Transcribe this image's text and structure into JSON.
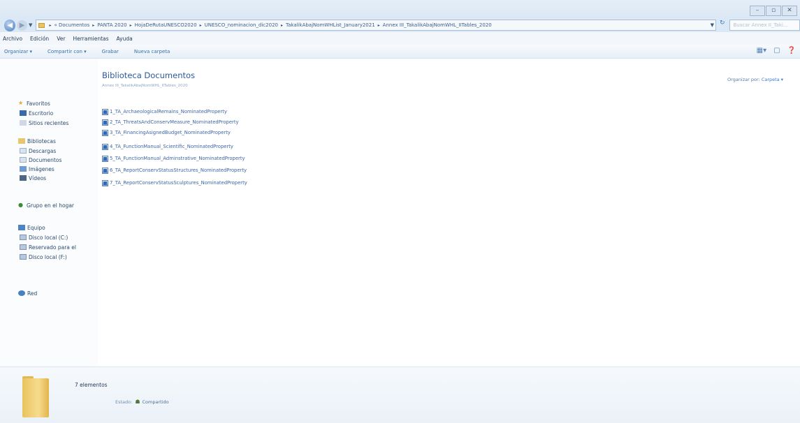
{
  "window": {
    "controls": [
      "–",
      "▫",
      "✕"
    ]
  },
  "address": {
    "back_icon": "back-arrow-icon",
    "forward_icon": "forward-arrow-icon",
    "dropdown_glyph": "▼",
    "breadcrumbs": [
      "« Documentos",
      "PANTA 2020",
      "HojaDeRutaUNESCO2020",
      "UNESCO_nominacion_dic2020",
      "TakalikAbajNomWHList_January2021",
      "Annex III_TakalikAbajNomWHL_IITables_2020"
    ],
    "separator": "▸",
    "refresh_glyph": "↻",
    "search_placeholder": "Buscar Annex II_Taki..."
  },
  "menubar": {
    "items": [
      "Archivo",
      "Edición",
      "Ver",
      "Herramientas",
      "Ayuda"
    ]
  },
  "commandbar": {
    "organize": "Organizar ▾",
    "share": "Compartir con ▾",
    "burn": "Grabar",
    "new_folder": "Nueva carpeta"
  },
  "navpane": {
    "favorites": "Favoritos",
    "desktop": "Escritorio",
    "recent": "Sitios recientes",
    "libraries": "Bibliotecas",
    "downloads": "Descargas",
    "documents": "Documentos",
    "images": "Imágenes",
    "videos": "Vídeos",
    "homegroup": "Grupo en el hogar",
    "computer": "Equipo",
    "disk_c": "Disco local (C:)",
    "reserved": "Reservado para el",
    "disk_f": "Disco local (F:)",
    "network": "Red"
  },
  "content": {
    "title": "Biblioteca Documentos",
    "subtitle": "Annex III_TakalikAbajNomWHL_IITables_2020",
    "arrange_label": "Organizar por:",
    "arrange_value": "Carpeta ▾",
    "files": [
      "1_TA_ArchaeologicalRemains_NominatedProperty",
      "2_TA_ThreatsAndConservMeasure_NominatedProperty",
      "3_TA_FinancingAsignedBudget_NominatedProperty",
      "4_TA_FunctionManual_Scientific_NominatedProperty",
      "5_TA_FunctionManual_Adminstrative_NominatedProperty",
      "6_TA_ReportConservStatusStructures_NominatedProperty",
      "7_TA_ReportConservStatusSculptures_NominatedProperty"
    ]
  },
  "details": {
    "count": "7 elementos",
    "state_label": "Estado:",
    "state_value": "Compartido"
  }
}
